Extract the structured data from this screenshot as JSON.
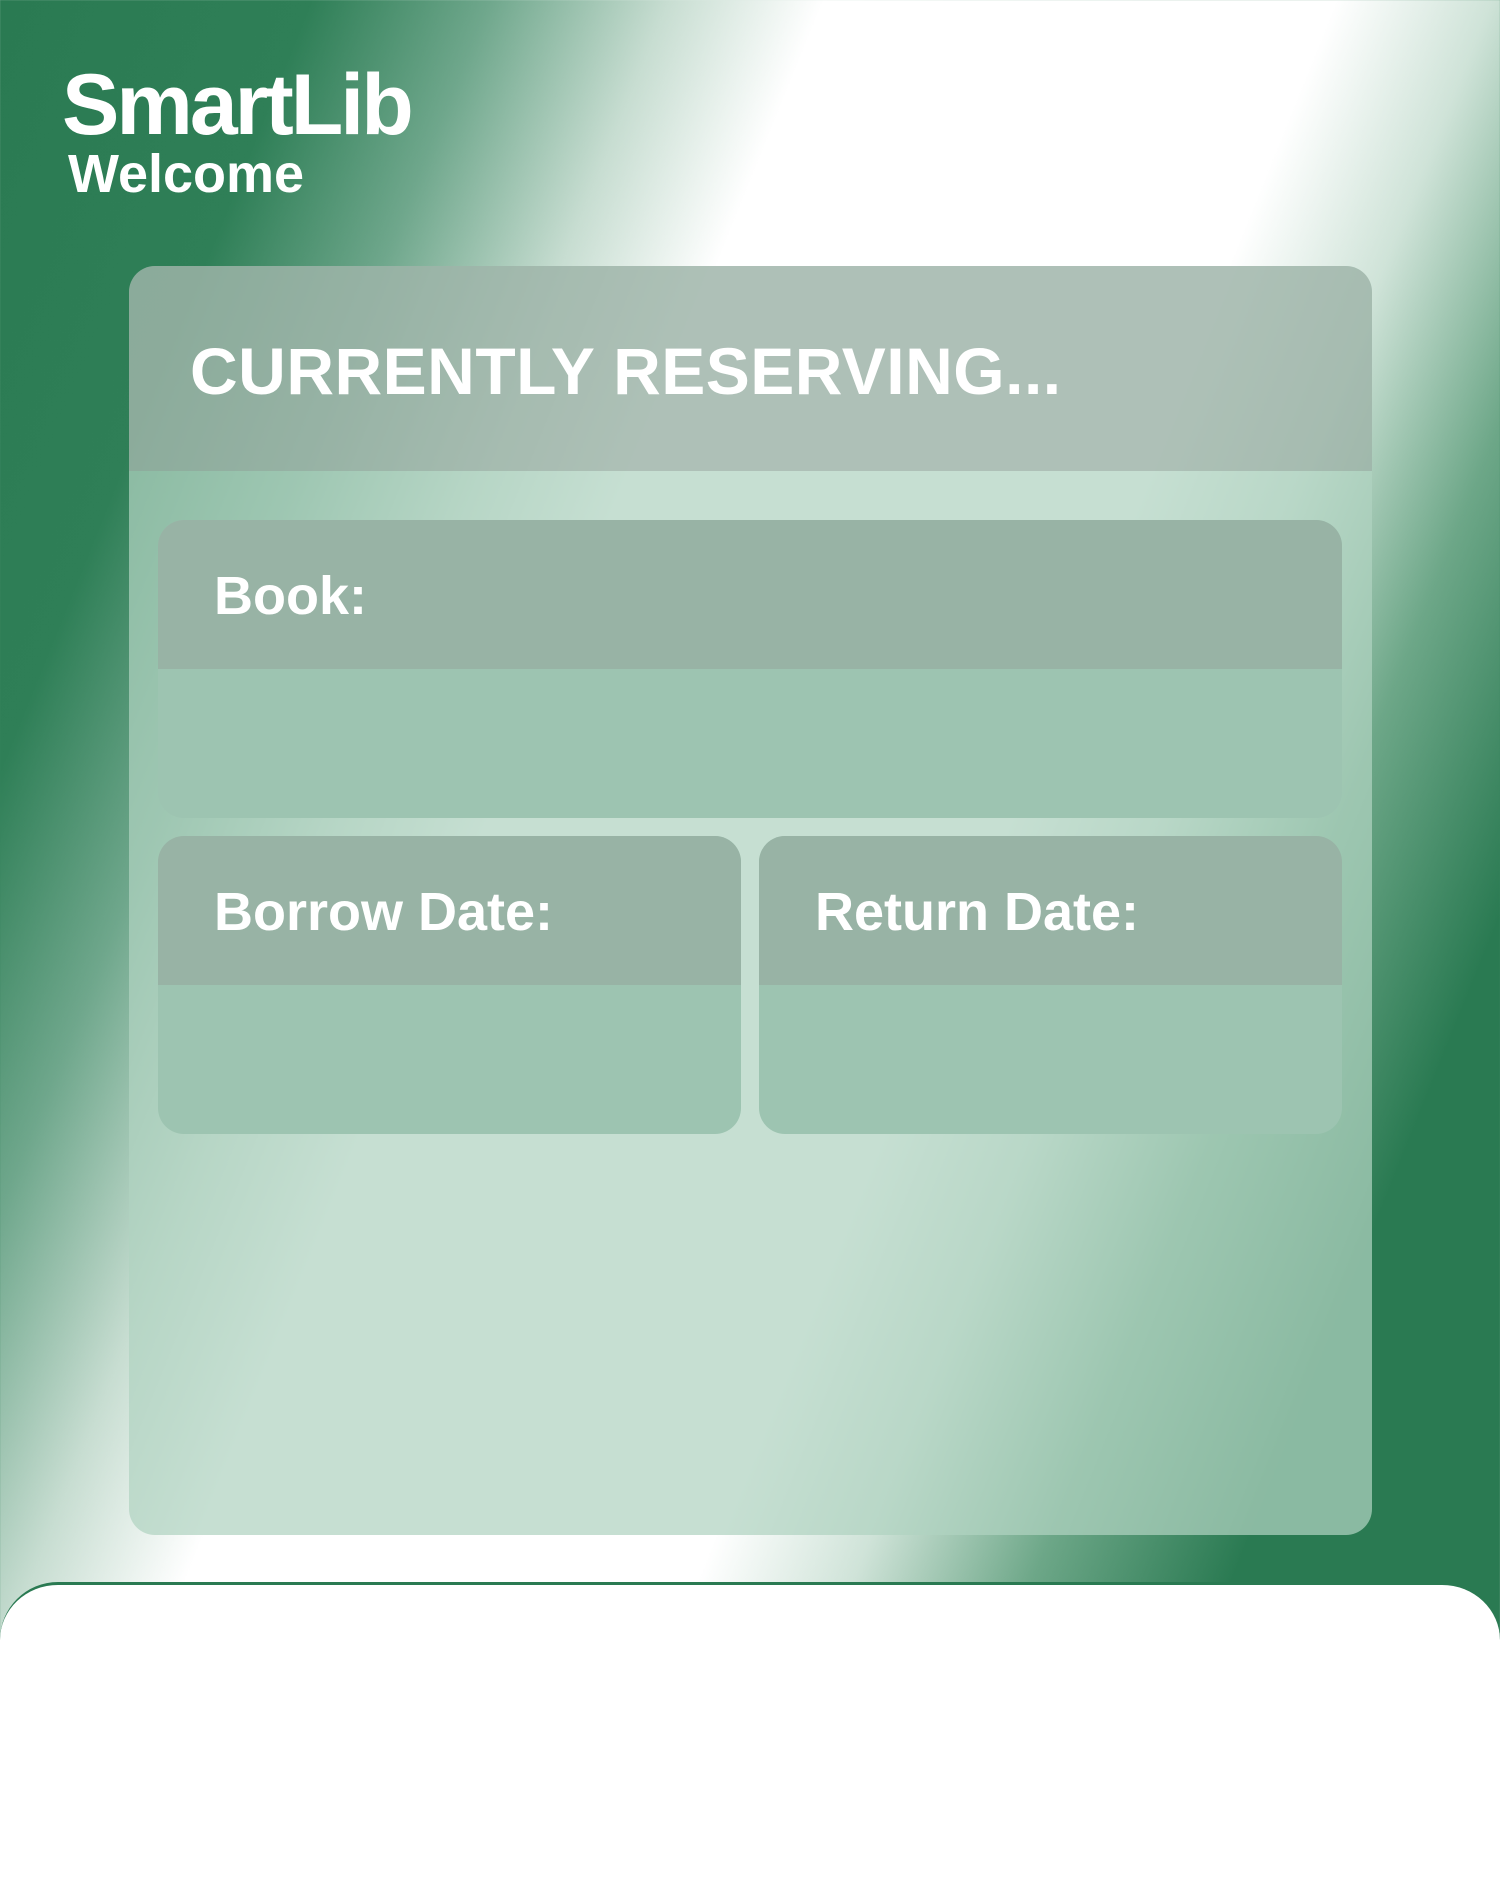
{
  "app": {
    "logo_text": "SmartLib",
    "welcome_text": "Welcome"
  },
  "reservation": {
    "title": "CURRENTLY RESERVING...",
    "book": {
      "label": "Book:",
      "value": ""
    },
    "borrow_date": {
      "label": "Borrow Date:",
      "value": ""
    },
    "return_date": {
      "label": "Return Date:",
      "value": ""
    }
  },
  "colors": {
    "brand_green": "#2a7a52",
    "panel_fill": "#c4dcd1",
    "field_header": "#98b3a5",
    "field_body": "#9dc4b1",
    "text": "#ffffff"
  }
}
